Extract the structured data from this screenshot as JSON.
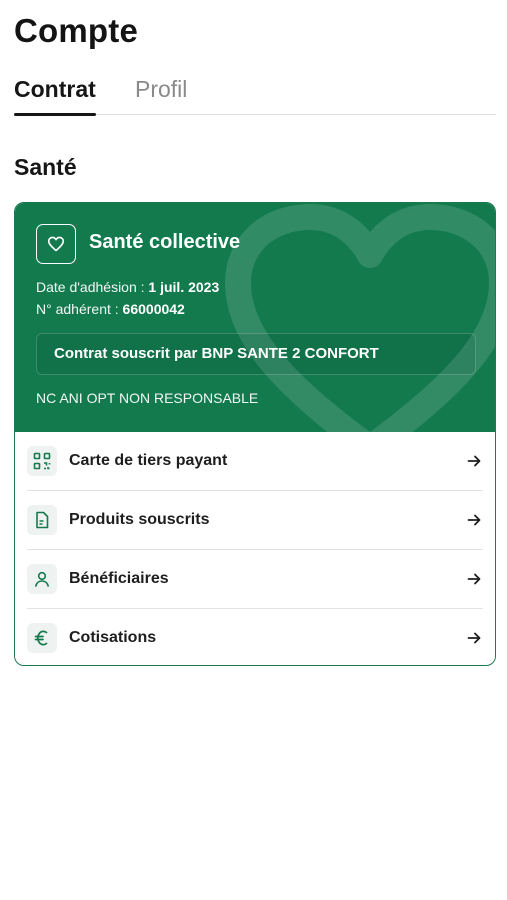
{
  "page": {
    "title": "Compte"
  },
  "tabs": [
    {
      "label": "Contrat",
      "active": true
    },
    {
      "label": "Profil",
      "active": false
    }
  ],
  "section": {
    "title": "Santé"
  },
  "card": {
    "title": "Santé collective",
    "icon": "heart-icon",
    "accent_color": "#137a4e",
    "adhesion_label": "Date d'adhésion : ",
    "adhesion_value": "1 juil. 2023",
    "member_label": "N° adhérent : ",
    "member_value": "66000042",
    "contract_text": "Contrat souscrit par BNP SANTE 2 CONFORT",
    "option_text": "NC ANI OPT NON RESPONSABLE"
  },
  "menu": [
    {
      "label": "Carte de tiers payant",
      "icon": "qr-code-icon"
    },
    {
      "label": "Produits souscrits",
      "icon": "document-icon"
    },
    {
      "label": "Bénéficiaires",
      "icon": "user-icon"
    },
    {
      "label": "Cotisations",
      "icon": "euro-icon"
    }
  ]
}
